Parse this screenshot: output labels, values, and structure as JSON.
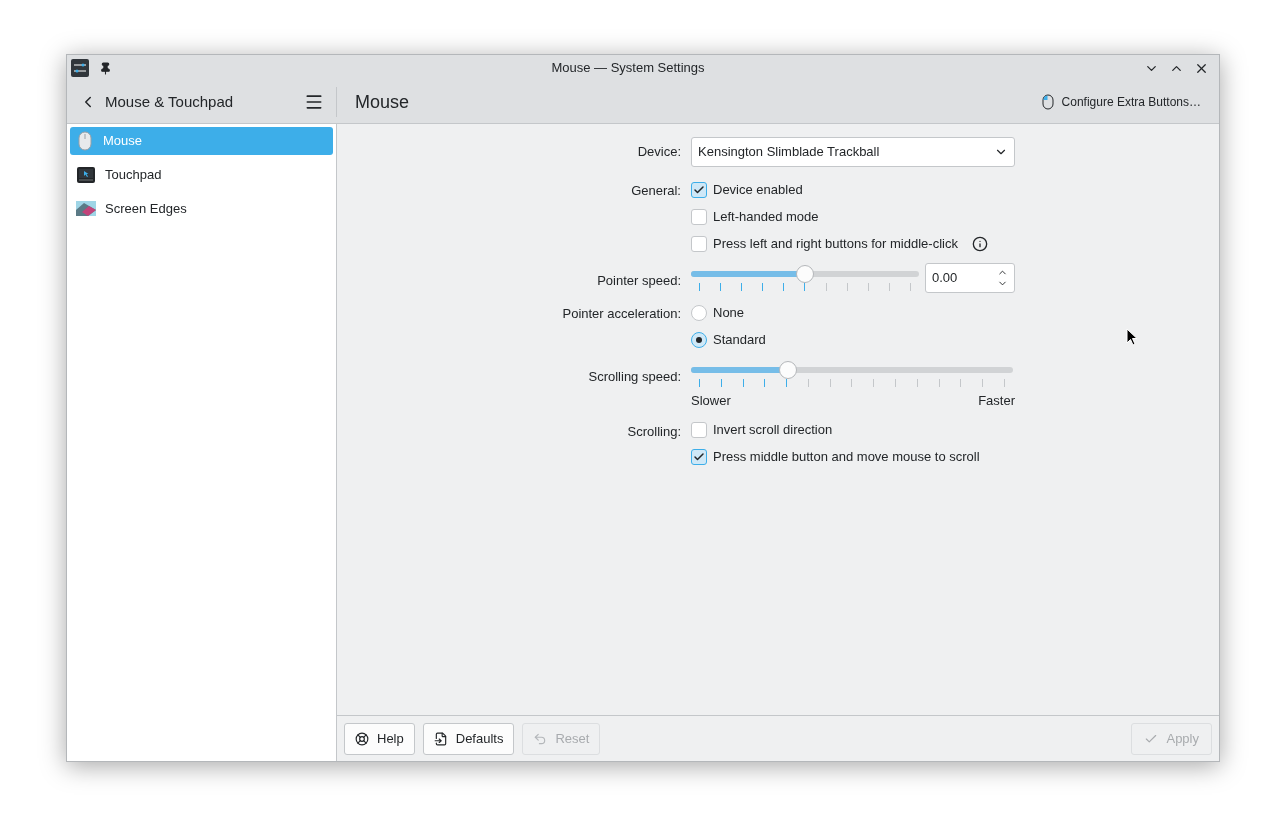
{
  "window": {
    "title": "Mouse — System Settings"
  },
  "sidebar": {
    "title": "Mouse & Touchpad",
    "items": [
      {
        "label": "Mouse",
        "kind": "mouse",
        "selected": true
      },
      {
        "label": "Touchpad",
        "kind": "touchpad",
        "selected": false
      },
      {
        "label": "Screen Edges",
        "kind": "edges",
        "selected": false
      }
    ]
  },
  "page": {
    "title": "Mouse",
    "action": "Configure Extra Buttons…"
  },
  "form": [
    {
      "kind": "combo",
      "label": "Device:",
      "value": "Kensington Slimblade Trackball"
    },
    {
      "kind": "checks",
      "label": "General:",
      "options": [
        {
          "label": "Device enabled",
          "checked": true,
          "info": false
        },
        {
          "label": "Left-handed mode",
          "checked": false,
          "info": false
        },
        {
          "label": "Press left and right buttons for middle-click",
          "checked": false,
          "info": true
        }
      ]
    },
    {
      "kind": "slider",
      "label": "Pointer speed:",
      "level": 0.5,
      "value": "0.00"
    },
    {
      "kind": "radios",
      "label": "Pointer acceleration:",
      "options": [
        {
          "label": "None",
          "selected": false
        },
        {
          "label": "Standard",
          "selected": true
        }
      ]
    },
    {
      "kind": "slider",
      "label": "Scrolling speed:",
      "level": 0.29,
      "min_label": "Slower",
      "max_label": "Faster"
    },
    {
      "kind": "checks",
      "label": "Scrolling:",
      "options": [
        {
          "label": "Invert scroll direction",
          "checked": false,
          "info": false
        },
        {
          "label": "Press middle button and move mouse to scroll",
          "checked": true,
          "info": false
        }
      ]
    }
  ],
  "footer": [
    {
      "label": "Help",
      "disabled": false
    },
    {
      "label": "Defaults",
      "disabled": false
    },
    {
      "label": "Reset",
      "disabled": true
    }
  ],
  "apply": {
    "label": "Apply",
    "disabled": true
  }
}
